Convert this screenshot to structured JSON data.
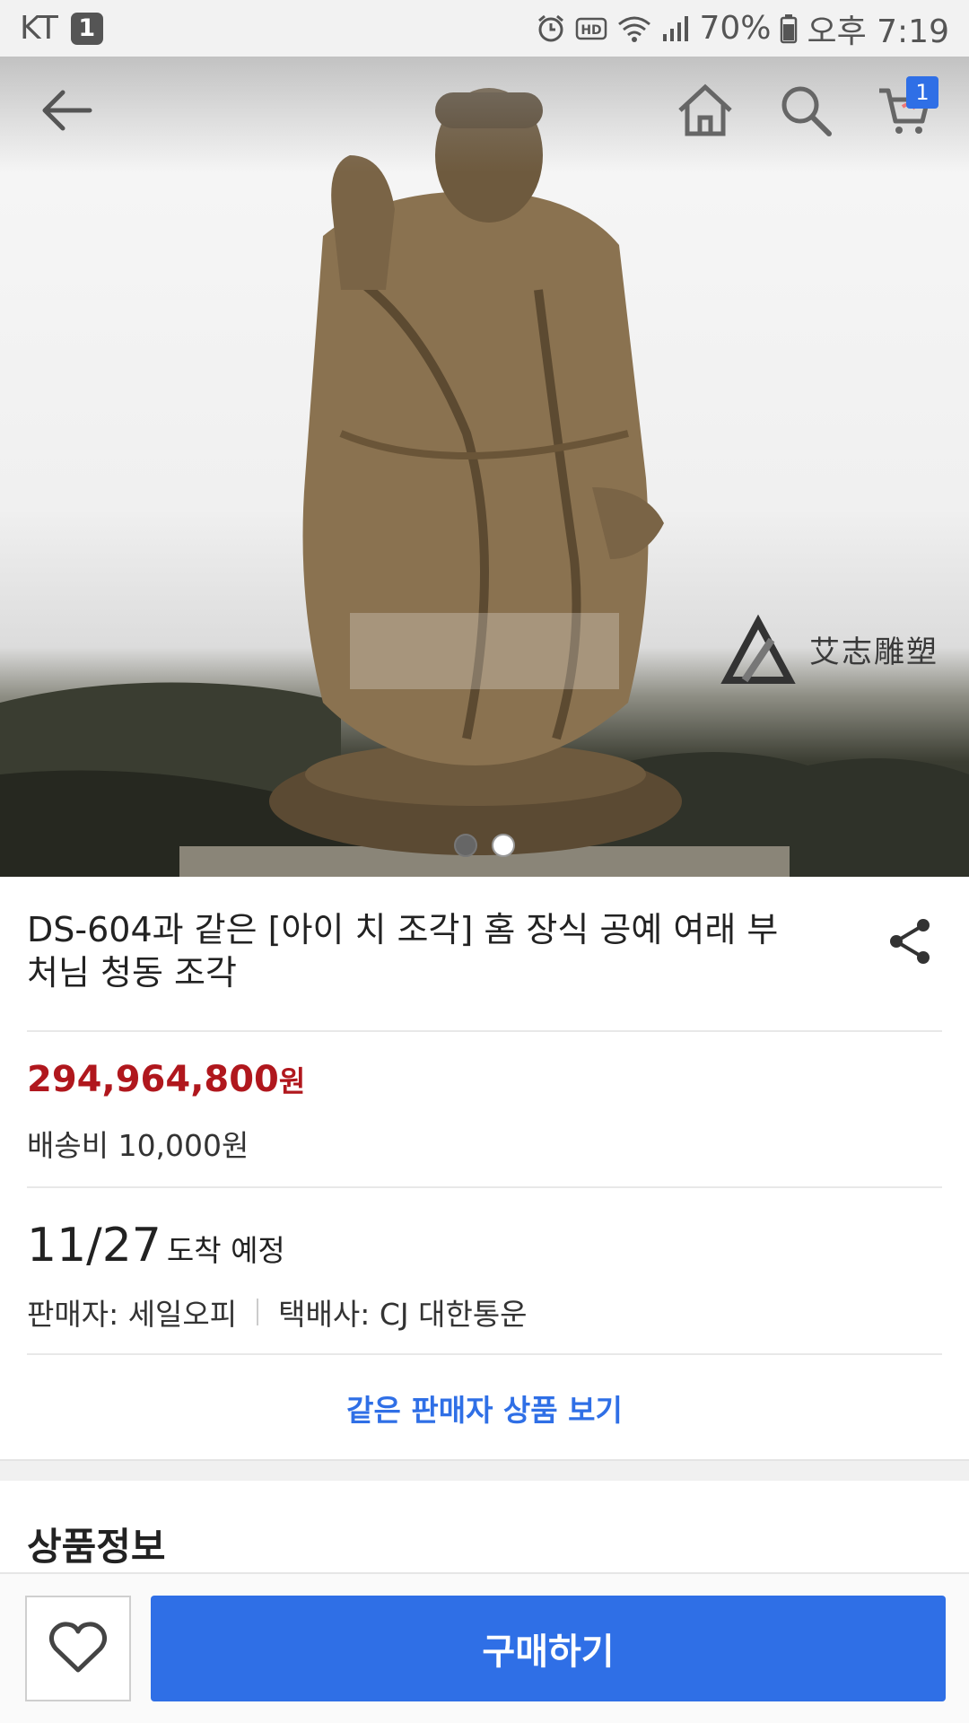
{
  "status_bar": {
    "carrier": "KT",
    "notification_count": "1",
    "battery": "70%",
    "time": "오후 7:19",
    "icons": [
      "alarm-icon",
      "hd-icon",
      "wifi-icon",
      "signal-icon",
      "battery-icon"
    ]
  },
  "hero": {
    "cart_count": "1",
    "watermark_text": "艾志雕塑",
    "slide_count": 2,
    "active_slide": 2,
    "icons": [
      "back-arrow-icon",
      "home-icon",
      "search-icon",
      "cart-icon"
    ]
  },
  "product": {
    "title": "DS-604과 같은 [아이 치 조각] 홈 장식 공예 여래 부처님 청동 조각",
    "price": "294,964,800",
    "price_unit": "원",
    "shipping": "배송비 10,000원",
    "arrival_date": "11/27",
    "arrival_suffix": "도착 예정",
    "seller": "판매자: 세일오피",
    "courier": "택배사: CJ 대한통운",
    "same_seller_link": "같은 판매자 상품 보기"
  },
  "section": {
    "title": "상품정보"
  },
  "bottom_bar": {
    "buy_label": "구매하기"
  },
  "colors": {
    "accent": "#2f6fe6",
    "price": "#b0171d"
  }
}
